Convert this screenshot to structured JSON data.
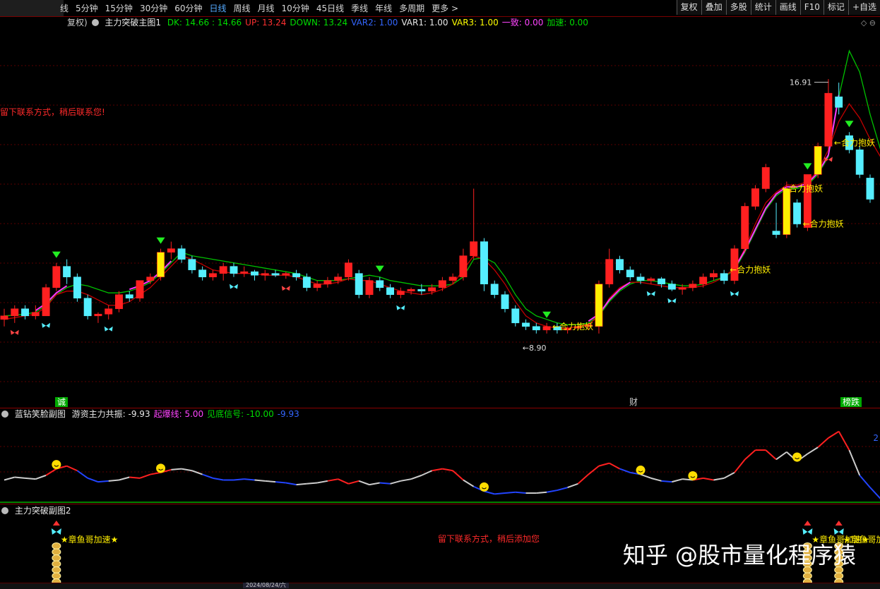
{
  "toolbar": {
    "periods": [
      "线",
      "5分钟",
      "15分钟",
      "30分钟",
      "60分钟",
      "日线",
      "周线",
      "月线",
      "10分钟",
      "45日线",
      "季线",
      "年线",
      "多周期",
      "更多 >"
    ],
    "active_period": "日线",
    "tools": [
      "复权",
      "叠加",
      "多股",
      "统计",
      "画线",
      "F10",
      "标记",
      "+自选"
    ]
  },
  "main_legend": {
    "prefix": "复权)",
    "name": "主力突破主图1",
    "items": [
      {
        "text": "DK: 14.66 : 14.66",
        "color": "#00dd00"
      },
      {
        "text": "UP: 13.24",
        "color": "#ff3030"
      },
      {
        "text": "DOWN: 13.24",
        "color": "#00dd00"
      },
      {
        "text": "VAR2: 1.00",
        "color": "#3366ff"
      },
      {
        "text": "VAR1: 1.00",
        "color": "#e8e8e8"
      },
      {
        "text": "VAR3: 1.00",
        "color": "#ffff00"
      },
      {
        "text": "一致: 0.00",
        "color": "#ff44ff"
      },
      {
        "text": "加速: 0.00",
        "color": "#00dd00"
      }
    ]
  },
  "corner_icon": "◇ ⊖",
  "contact_msg": "留下联系方式，稍后联系您!",
  "contact_msg2": "留下联系方式，稍后添加您",
  "price_labels": {
    "high": "16.91",
    "low": "8.90"
  },
  "signal_text": "合力抱妖",
  "tags": {
    "left": "诚",
    "mid": "财",
    "right": "榜跌"
  },
  "sub1_legend": {
    "name": "蓝钻笑脸副图",
    "items": [
      {
        "text": "游资主力共振: -9.93",
        "color": "#e8e8e8"
      },
      {
        "text": "起爆线: 5.00",
        "color": "#ff44ff"
      },
      {
        "text": "见底信号: -10.00",
        "color": "#00dd00"
      },
      {
        "text": "-9.93",
        "color": "#3366ff"
      }
    ]
  },
  "sub2_legend": {
    "name": "主力突破副图2"
  },
  "octopus_text": "章鱼哥加速★",
  "watermark": "知乎 @股市量化程序猿",
  "axis_right_label": "2",
  "bottom_date": "2024/08/24/六",
  "colors": {
    "up": "#ff2020",
    "down": "#55eeff",
    "ma_green": "#00c000",
    "ma_red": "#c00000",
    "magenta": "#ff33ff",
    "yellow": "#ffee00"
  },
  "chart_data": {
    "type": "candlestick",
    "title": "",
    "ylim": [
      8.0,
      18.5
    ],
    "series": [
      {
        "name": "candles",
        "values": [
          {
            "o": 10.2,
            "h": 10.5,
            "l": 10.0,
            "c": 10.3
          },
          {
            "o": 10.3,
            "h": 10.6,
            "l": 10.1,
            "c": 10.5
          },
          {
            "o": 10.5,
            "h": 10.6,
            "l": 10.2,
            "c": 10.3
          },
          {
            "o": 10.3,
            "h": 10.6,
            "l": 10.2,
            "c": 10.4
          },
          {
            "o": 10.3,
            "h": 11.2,
            "l": 10.3,
            "c": 11.1
          },
          {
            "o": 11.1,
            "h": 11.8,
            "l": 11.0,
            "c": 11.7
          },
          {
            "o": 11.7,
            "h": 11.9,
            "l": 11.2,
            "c": 11.4
          },
          {
            "o": 11.4,
            "h": 11.5,
            "l": 10.7,
            "c": 10.8
          },
          {
            "o": 10.8,
            "h": 10.9,
            "l": 10.2,
            "c": 10.3
          },
          {
            "o": 10.3,
            "h": 10.4,
            "l": 10.1,
            "c": 10.35
          },
          {
            "o": 10.35,
            "h": 10.6,
            "l": 10.2,
            "c": 10.5
          },
          {
            "o": 10.5,
            "h": 11.0,
            "l": 10.4,
            "c": 10.9
          },
          {
            "o": 10.9,
            "h": 11.0,
            "l": 10.7,
            "c": 10.8
          },
          {
            "o": 10.8,
            "h": 11.3,
            "l": 10.7,
            "c": 11.3
          },
          {
            "o": 11.3,
            "h": 11.5,
            "l": 11.2,
            "c": 11.4
          },
          {
            "o": 11.4,
            "h": 12.2,
            "l": 11.3,
            "c": 12.1
          },
          {
            "o": 12.1,
            "h": 12.4,
            "l": 11.9,
            "c": 12.2
          },
          {
            "o": 12.2,
            "h": 12.3,
            "l": 11.8,
            "c": 11.9
          },
          {
            "o": 11.9,
            "h": 12.0,
            "l": 11.5,
            "c": 11.6
          },
          {
            "o": 11.6,
            "h": 11.7,
            "l": 11.3,
            "c": 11.4
          },
          {
            "o": 11.4,
            "h": 11.6,
            "l": 11.3,
            "c": 11.5
          },
          {
            "o": 11.5,
            "h": 11.8,
            "l": 11.3,
            "c": 11.7
          },
          {
            "o": 11.7,
            "h": 11.8,
            "l": 11.4,
            "c": 11.5
          },
          {
            "o": 11.5,
            "h": 11.7,
            "l": 11.4,
            "c": 11.55
          },
          {
            "o": 11.55,
            "h": 11.6,
            "l": 11.3,
            "c": 11.45
          },
          {
            "o": 11.45,
            "h": 11.6,
            "l": 11.3,
            "c": 11.5
          },
          {
            "o": 11.5,
            "h": 11.6,
            "l": 11.4,
            "c": 11.45
          },
          {
            "o": 11.45,
            "h": 11.55,
            "l": 11.35,
            "c": 11.5
          },
          {
            "o": 11.5,
            "h": 11.6,
            "l": 11.3,
            "c": 11.4
          },
          {
            "o": 11.4,
            "h": 11.5,
            "l": 11.0,
            "c": 11.1
          },
          {
            "o": 11.1,
            "h": 11.3,
            "l": 11.0,
            "c": 11.2
          },
          {
            "o": 11.2,
            "h": 11.4,
            "l": 11.1,
            "c": 11.3
          },
          {
            "o": 11.3,
            "h": 11.5,
            "l": 11.2,
            "c": 11.4
          },
          {
            "o": 11.4,
            "h": 11.9,
            "l": 11.3,
            "c": 11.8
          },
          {
            "o": 11.5,
            "h": 11.6,
            "l": 10.8,
            "c": 10.9
          },
          {
            "o": 10.9,
            "h": 11.4,
            "l": 10.8,
            "c": 11.3
          },
          {
            "o": 11.3,
            "h": 11.4,
            "l": 11.0,
            "c": 11.1
          },
          {
            "o": 11.1,
            "h": 11.2,
            "l": 10.8,
            "c": 10.9
          },
          {
            "o": 10.9,
            "h": 11.1,
            "l": 10.8,
            "c": 11.0
          },
          {
            "o": 11.0,
            "h": 11.1,
            "l": 10.9,
            "c": 11.05
          },
          {
            "o": 11.05,
            "h": 11.2,
            "l": 10.9,
            "c": 11.0
          },
          {
            "o": 11.0,
            "h": 11.2,
            "l": 10.9,
            "c": 11.1
          },
          {
            "o": 11.1,
            "h": 11.4,
            "l": 11.0,
            "c": 11.3
          },
          {
            "o": 11.3,
            "h": 11.5,
            "l": 11.2,
            "c": 11.4
          },
          {
            "o": 11.4,
            "h": 12.2,
            "l": 11.3,
            "c": 12.0
          },
          {
            "o": 12.0,
            "h": 13.9,
            "l": 11.9,
            "c": 12.4
          },
          {
            "o": 12.4,
            "h": 12.5,
            "l": 11.0,
            "c": 11.2
          },
          {
            "o": 11.2,
            "h": 11.3,
            "l": 10.8,
            "c": 10.9
          },
          {
            "o": 10.9,
            "h": 11.0,
            "l": 10.4,
            "c": 10.5
          },
          {
            "o": 10.5,
            "h": 10.6,
            "l": 10.0,
            "c": 10.1
          },
          {
            "o": 10.1,
            "h": 10.2,
            "l": 9.9,
            "c": 10.0
          },
          {
            "o": 10.0,
            "h": 10.1,
            "l": 9.8,
            "c": 9.9
          },
          {
            "o": 9.9,
            "h": 10.1,
            "l": 9.8,
            "c": 10.0
          },
          {
            "o": 10.0,
            "h": 10.1,
            "l": 9.8,
            "c": 9.9
          },
          {
            "o": 9.9,
            "h": 10.0,
            "l": 9.8,
            "c": 9.95
          },
          {
            "o": 9.95,
            "h": 10.1,
            "l": 9.9,
            "c": 10.0
          },
          {
            "o": 10.0,
            "h": 10.1,
            "l": 9.9,
            "c": 10.05
          },
          {
            "o": 10.0,
            "h": 11.3,
            "l": 9.8,
            "c": 11.2
          },
          {
            "o": 11.2,
            "h": 12.2,
            "l": 11.1,
            "c": 11.9
          },
          {
            "o": 11.9,
            "h": 12.0,
            "l": 11.5,
            "c": 11.6
          },
          {
            "o": 11.6,
            "h": 11.7,
            "l": 11.3,
            "c": 11.4
          },
          {
            "o": 11.4,
            "h": 11.5,
            "l": 11.2,
            "c": 11.3
          },
          {
            "o": 11.3,
            "h": 11.4,
            "l": 11.2,
            "c": 11.35
          },
          {
            "o": 11.35,
            "h": 11.4,
            "l": 11.1,
            "c": 11.2
          },
          {
            "o": 11.2,
            "h": 11.3,
            "l": 11.0,
            "c": 11.05
          },
          {
            "o": 11.05,
            "h": 11.2,
            "l": 10.9,
            "c": 11.1
          },
          {
            "o": 11.1,
            "h": 11.3,
            "l": 11.0,
            "c": 11.2
          },
          {
            "o": 11.2,
            "h": 11.5,
            "l": 11.1,
            "c": 11.4
          },
          {
            "o": 11.4,
            "h": 11.6,
            "l": 11.3,
            "c": 11.5
          },
          {
            "o": 11.5,
            "h": 11.6,
            "l": 11.2,
            "c": 11.3
          },
          {
            "o": 11.3,
            "h": 12.3,
            "l": 11.2,
            "c": 12.2
          },
          {
            "o": 12.2,
            "h": 13.5,
            "l": 12.1,
            "c": 13.4
          },
          {
            "o": 13.4,
            "h": 14.0,
            "l": 13.3,
            "c": 13.9
          },
          {
            "o": 13.9,
            "h": 14.6,
            "l": 13.8,
            "c": 14.5
          },
          {
            "o": 12.7,
            "h": 13.5,
            "l": 12.5,
            "c": 12.6
          },
          {
            "o": 12.6,
            "h": 14.1,
            "l": 12.5,
            "c": 13.9
          },
          {
            "o": 13.5,
            "h": 13.6,
            "l": 12.8,
            "c": 12.9
          },
          {
            "o": 12.8,
            "h": 14.3,
            "l": 12.7,
            "c": 14.3
          },
          {
            "o": 14.3,
            "h": 15.2,
            "l": 14.2,
            "c": 15.1
          },
          {
            "o": 15.1,
            "h": 17.0,
            "l": 15.0,
            "c": 16.6
          },
          {
            "o": 16.5,
            "h": 16.9,
            "l": 16.0,
            "c": 16.2
          },
          {
            "o": 15.4,
            "h": 15.5,
            "l": 14.9,
            "c": 15.0
          },
          {
            "o": 15.0,
            "h": 15.1,
            "l": 14.2,
            "c": 14.3
          },
          {
            "o": 14.2,
            "h": 14.3,
            "l": 13.5,
            "c": 13.6
          }
        ]
      },
      {
        "name": "ma_green",
        "values": [
          10.3,
          10.32,
          10.35,
          10.4,
          10.6,
          10.9,
          11.1,
          11.2,
          11.15,
          11.05,
          10.95,
          10.95,
          11.0,
          11.1,
          11.25,
          11.5,
          11.8,
          12.1,
          12.0,
          11.95,
          11.9,
          11.85,
          11.8,
          11.75,
          11.7,
          11.65,
          11.6,
          11.55,
          11.5,
          11.4,
          11.3,
          11.3,
          11.3,
          11.35,
          11.4,
          11.45,
          11.4,
          11.3,
          11.25,
          11.2,
          11.15,
          11.15,
          11.15,
          11.2,
          11.4,
          11.9,
          11.95,
          11.8,
          11.4,
          10.9,
          10.5,
          10.3,
          10.2,
          10.1,
          10.05,
          10.05,
          10.1,
          10.3,
          10.7,
          11.0,
          11.2,
          11.3,
          11.3,
          11.25,
          11.2,
          11.15,
          11.15,
          11.2,
          11.3,
          11.4,
          11.6,
          12.1,
          12.7,
          13.3,
          13.7,
          13.9,
          13.9,
          14.0,
          14.3,
          14.8,
          16.5,
          17.8,
          17.2,
          16.0,
          15.0
        ]
      },
      {
        "name": "ma_red",
        "values": [
          10.2,
          10.25,
          10.3,
          10.35,
          10.55,
          10.9,
          11.0,
          11.0,
          10.9,
          10.75,
          10.6,
          10.6,
          10.7,
          10.9,
          11.1,
          11.4,
          11.7,
          12.0,
          11.9,
          11.75,
          11.6,
          11.55,
          11.5,
          11.5,
          11.5,
          11.45,
          11.45,
          11.45,
          11.4,
          11.3,
          11.2,
          11.2,
          11.25,
          11.35,
          11.3,
          11.3,
          11.2,
          11.1,
          11.0,
          10.95,
          10.9,
          10.95,
          11.05,
          11.2,
          11.6,
          12.0,
          11.9,
          11.6,
          11.2,
          10.7,
          10.3,
          10.1,
          10.0,
          9.95,
          9.95,
          10.0,
          10.05,
          10.3,
          10.8,
          11.1,
          11.25,
          11.25,
          11.2,
          11.15,
          11.1,
          11.1,
          11.1,
          11.15,
          11.25,
          11.4,
          11.65,
          12.2,
          12.9,
          13.5,
          13.8,
          14.0,
          14.0,
          14.1,
          14.4,
          15.0,
          15.8,
          16.3,
          15.9,
          15.3,
          14.8
        ]
      }
    ],
    "annotations": {
      "high": 16.91,
      "low": 8.9
    },
    "sub1": {
      "type": "line",
      "values": [
        2,
        2.3,
        2.2,
        2.1,
        2.5,
        3.2,
        3.5,
        3.0,
        2.2,
        1.8,
        1.9,
        2.0,
        2.3,
        2.2,
        2.6,
        2.8,
        3.1,
        3.2,
        3.0,
        2.6,
        2.2,
        2.0,
        2.0,
        2.1,
        2.0,
        1.9,
        1.8,
        1.7,
        1.5,
        1.6,
        1.7,
        1.9,
        2.1,
        1.6,
        1.9,
        1.5,
        1.7,
        1.6,
        1.9,
        2.1,
        2.5,
        3.0,
        3.2,
        3.0,
        2.0,
        1.3,
        0.8,
        0.5,
        0.6,
        0.7,
        0.6,
        0.6,
        0.7,
        0.9,
        1.2,
        1.6,
        2.6,
        3.5,
        3.8,
        3.2,
        2.8,
        2.6,
        2.2,
        1.9,
        1.8,
        2.1,
        2.0,
        2.2,
        2.0,
        2.2,
        2.8,
        4.2,
        5.2,
        5.2,
        4.2,
        5.0,
        4.0,
        4.8,
        5.5,
        6.5,
        7.2,
        5.2,
        2.5,
        1.2,
        0.0
      ],
      "colors": [
        "w",
        "w",
        "w",
        "w",
        "r",
        "r",
        "r",
        "b",
        "b",
        "b",
        "w",
        "w",
        "r",
        "r",
        "r",
        "r",
        "w",
        "w",
        "w",
        "b",
        "b",
        "b",
        "b",
        "b",
        "w",
        "w",
        "b",
        "b",
        "w",
        "w",
        "w",
        "r",
        "r",
        "r",
        "w",
        "w",
        "b",
        "w",
        "w",
        "w",
        "w",
        "r",
        "r",
        "r",
        "w",
        "b",
        "b",
        "b",
        "b",
        "b",
        "w",
        "w",
        "b",
        "b",
        "w",
        "r",
        "r",
        "r",
        "r",
        "b",
        "b",
        "w",
        "w",
        "b",
        "w",
        "w",
        "r",
        "r",
        "w",
        "w",
        "r",
        "r",
        "r",
        "r",
        "w",
        "w",
        "w",
        "w",
        "r",
        "r",
        "r",
        "w",
        "b",
        "b",
        "b"
      ]
    }
  }
}
